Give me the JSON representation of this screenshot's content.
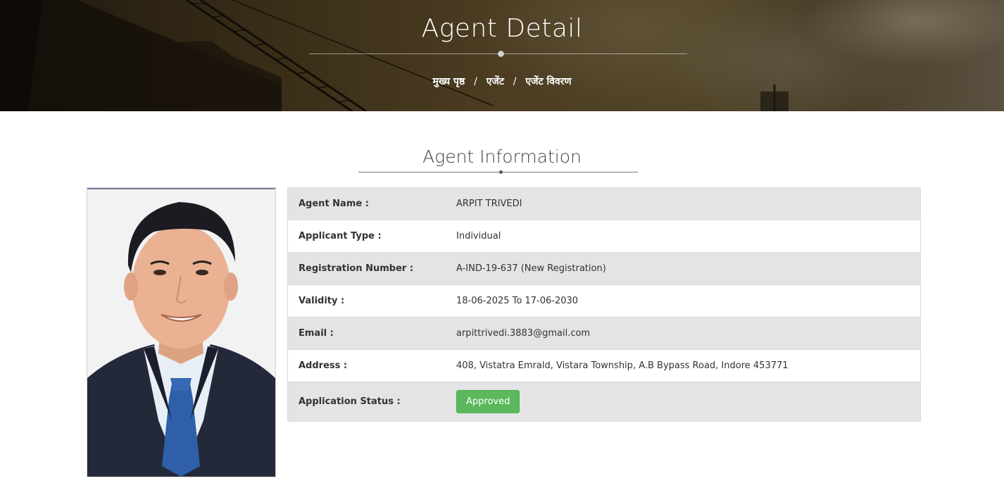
{
  "banner": {
    "title": "Agent Detail",
    "breadcrumb": [
      {
        "label": "मुख्य पृष्ठ"
      },
      {
        "label": "एजेंट"
      },
      {
        "label": "एजेंट विवरण"
      }
    ],
    "separator": "/"
  },
  "section": {
    "title": "Agent Information"
  },
  "details": [
    {
      "label": "Agent Name :",
      "value": "ARPIT TRIVEDI"
    },
    {
      "label": "Applicant Type :",
      "value": "Individual"
    },
    {
      "label": "Registration Number :",
      "value": "A-IND-19-637 (New Registration)"
    },
    {
      "label": "Validity :",
      "value": "18-06-2025 To 17-06-2030"
    },
    {
      "label": "Email :",
      "value": "arpittrivedi.3883@gmail.com"
    },
    {
      "label": "Address :",
      "value": "408, Vistatra Emrald, Vistara Township, A.B Bypass Road, Indore 453771"
    },
    {
      "label": "Application Status :",
      "value": "Approved"
    }
  ],
  "colors": {
    "status_approved": "#5cb85c",
    "row_alt": "#e4e4e4"
  },
  "photo": {
    "icon": "agent-photo"
  }
}
